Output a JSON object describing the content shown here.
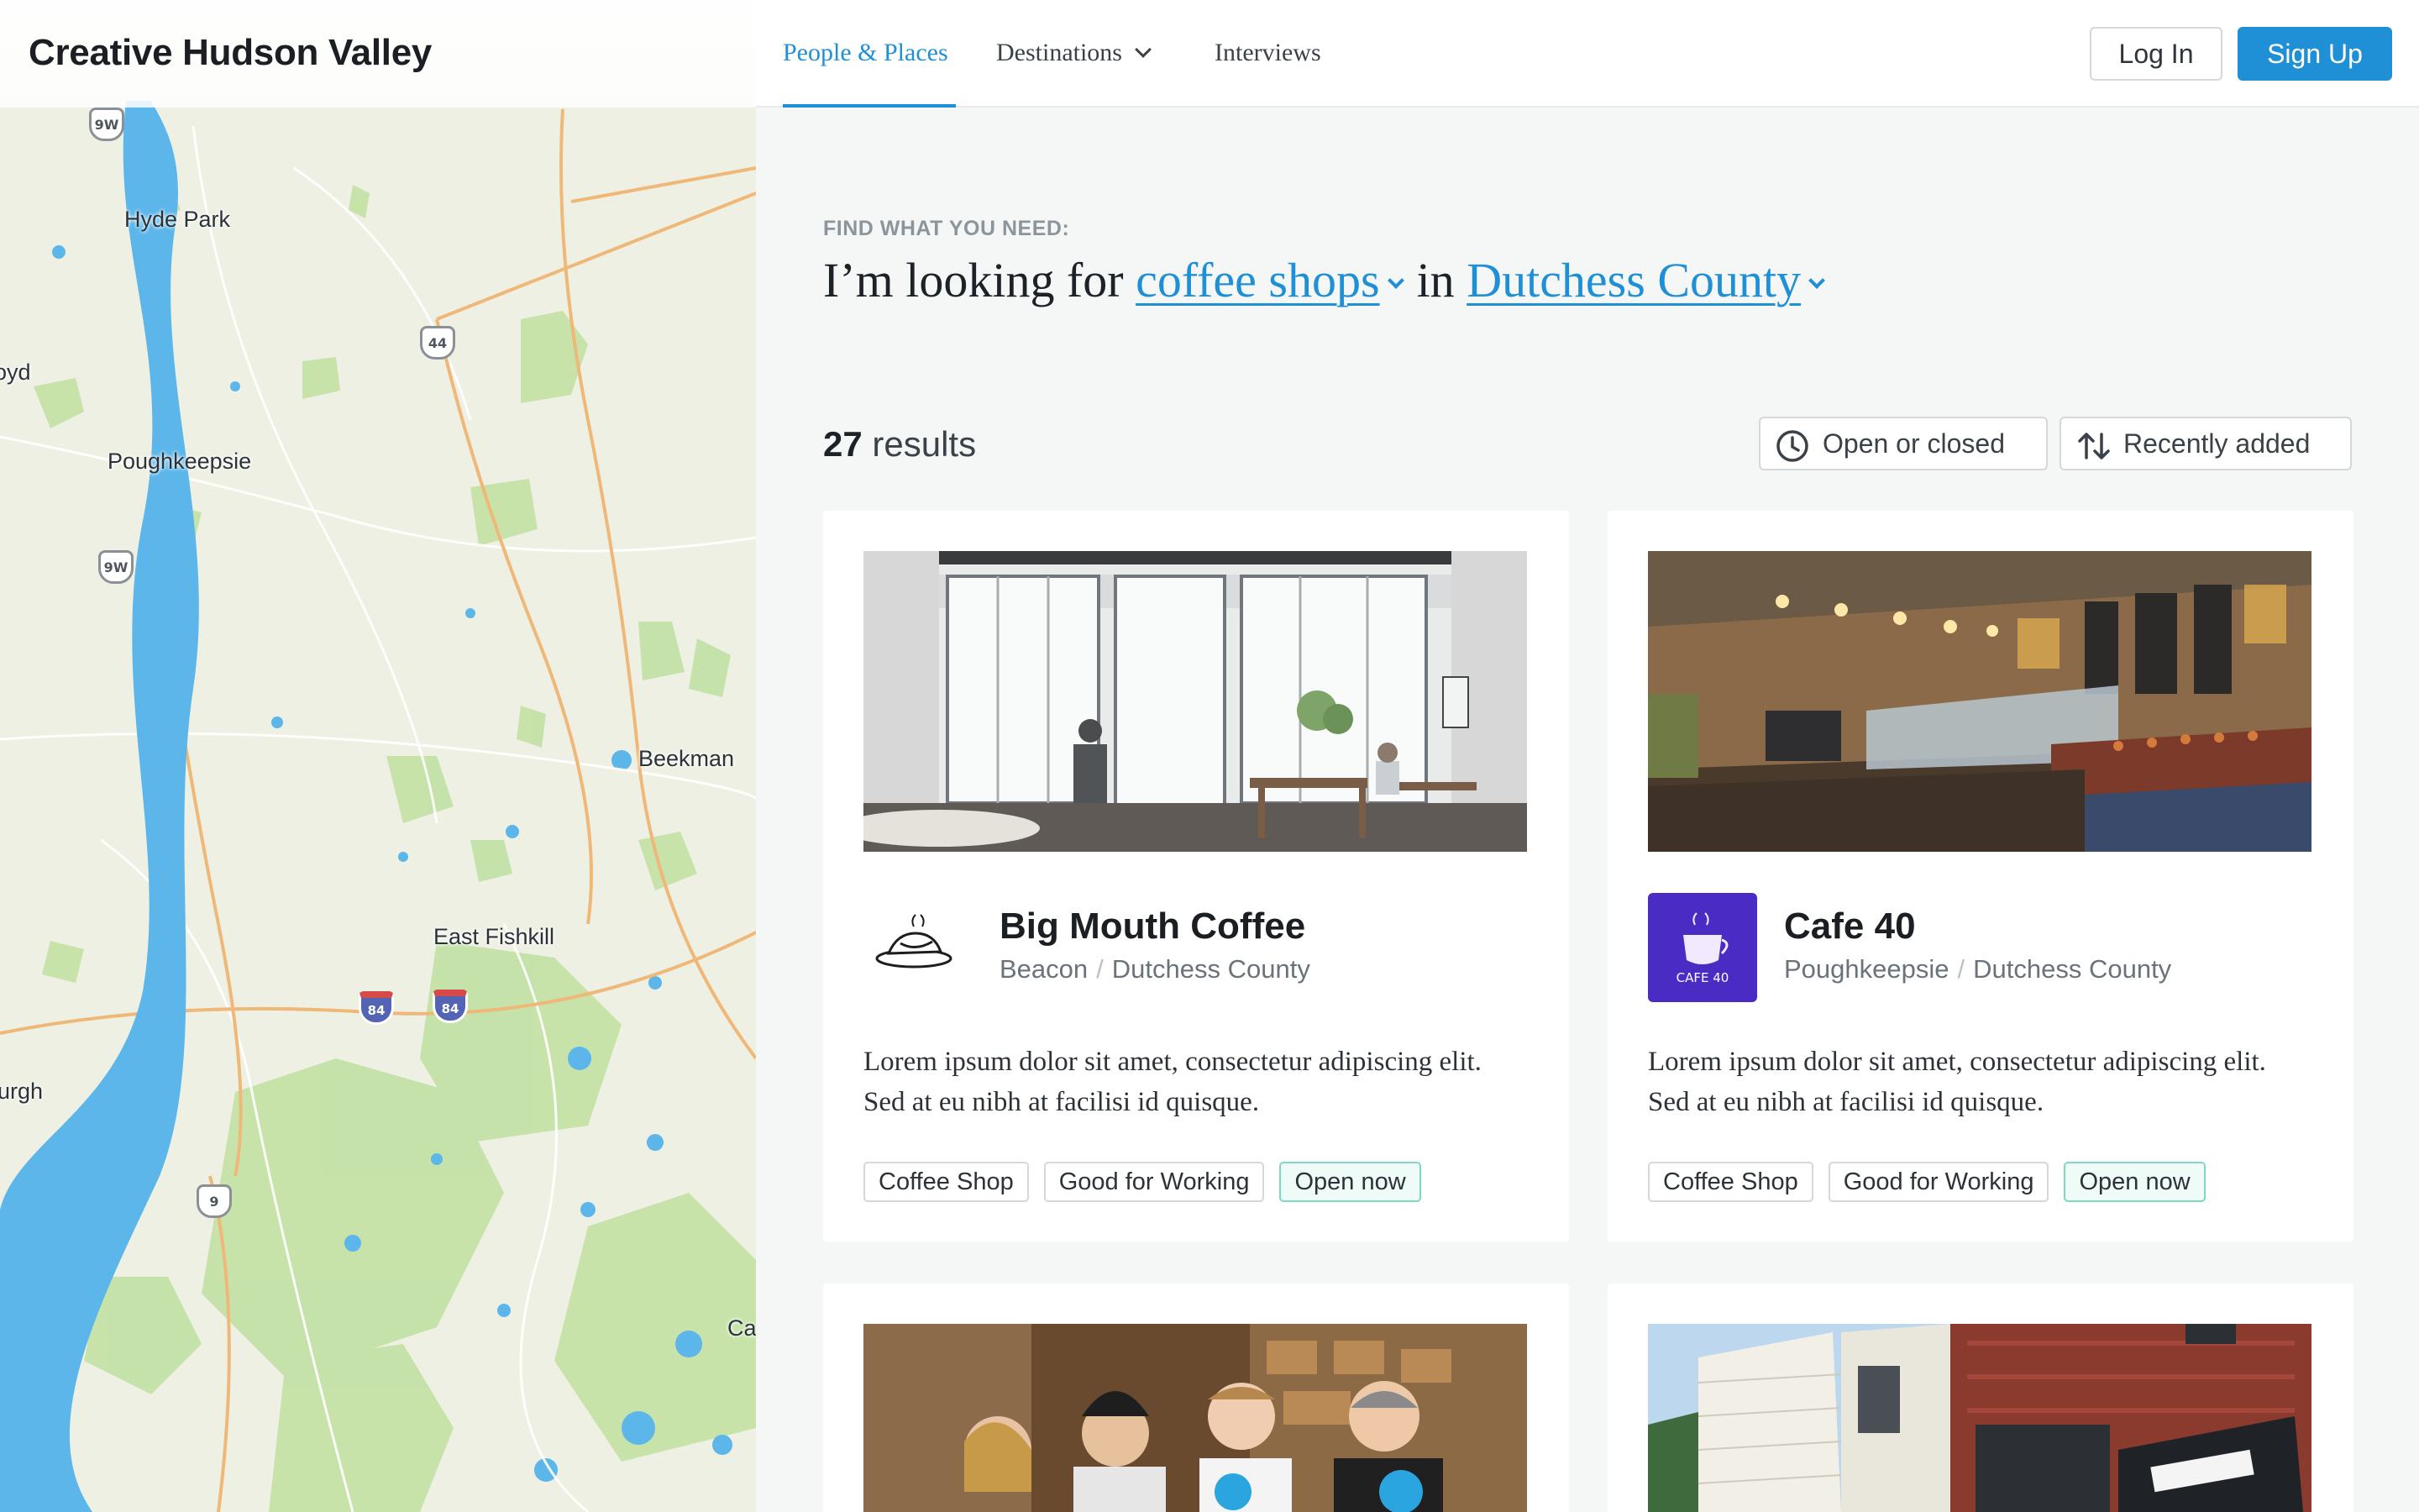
{
  "brand": {
    "title": "Creative Hudson Valley"
  },
  "map": {
    "towns": [
      "Hyde Park",
      "Lloyd",
      "Poughkeepsie",
      "Beekman",
      "East Fishkill",
      "Newburgh",
      "Ca"
    ],
    "shields": [
      "9W",
      "44",
      "9W",
      "84",
      "84",
      "9"
    ],
    "colors": {
      "land": "#eef0e4",
      "green": "#b9dd9a",
      "water": "#5cb6ea",
      "road": "#f0b878"
    }
  },
  "nav": {
    "items": [
      {
        "label": "People & Places",
        "active": true
      },
      {
        "label": "Destinations",
        "active": false
      },
      {
        "label": "Interviews",
        "active": false
      }
    ],
    "login": "Log In",
    "signup": "Sign Up"
  },
  "search": {
    "label": "FIND WHAT YOU NEED:",
    "prefix": "I’m looking for",
    "category": "coffee shops",
    "connector": "in",
    "location": "Dutchess County"
  },
  "results": {
    "count": "27",
    "label": "results",
    "filter_open": "Open or closed",
    "sort": "Recently added"
  },
  "cards": [
    {
      "name": "Big Mouth Coffee",
      "town": "Beacon",
      "county": "Dutchess County",
      "description": "Lorem ipsum dolor sit amet, consectetur adipiscing elit. Sed at eu nibh at facilisi id quisque.",
      "tags": [
        "Coffee Shop",
        "Good for Working",
        "Open now"
      ]
    },
    {
      "name": "Cafe 40",
      "town": "Poughkeepsie",
      "county": "Dutchess County",
      "logo_text": "CAFE 40",
      "description": "Lorem ipsum dolor sit amet, consectetur adipiscing elit. Sed at eu nibh at facilisi id quisque.",
      "tags": [
        "Coffee Shop",
        "Good for Working",
        "Open now"
      ]
    },
    {
      "photo": "people-photo"
    },
    {
      "photo": "street-photo"
    }
  ],
  "accent": "#1f8fd6"
}
